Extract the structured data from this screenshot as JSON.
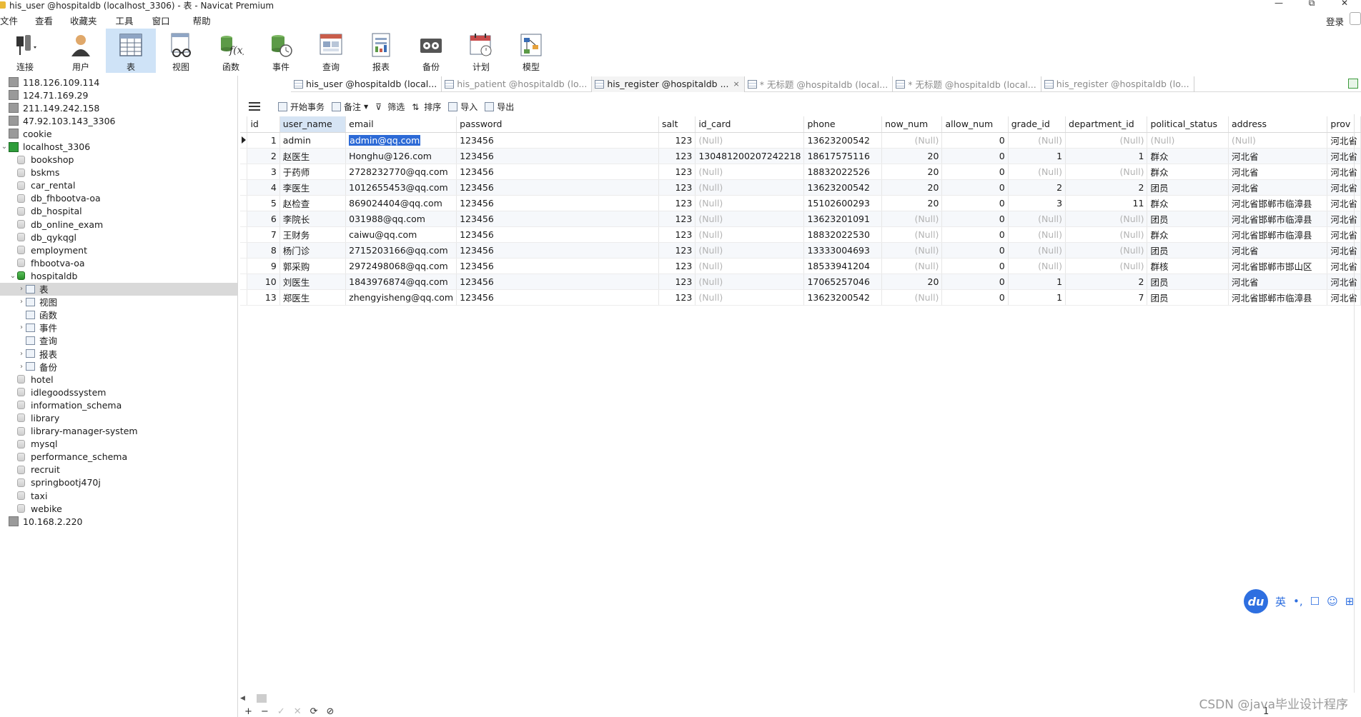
{
  "window": {
    "title": "his_user @hospitaldb (localhost_3306) - 表 - Navicat Premium",
    "minimize": "—",
    "maximize": "⧉",
    "close": "✕"
  },
  "menu": [
    "文件",
    "查看",
    "收藏夹",
    "工具",
    "窗口",
    "帮助"
  ],
  "login_label": "登录",
  "toolbar": [
    {
      "label": "连接",
      "icon": "plug-icon"
    },
    {
      "label": "用户",
      "icon": "user-icon"
    },
    {
      "label": "表",
      "icon": "table-icon",
      "active": true
    },
    {
      "label": "视图",
      "icon": "view-icon"
    },
    {
      "label": "函数",
      "icon": "function-icon"
    },
    {
      "label": "事件",
      "icon": "event-icon"
    },
    {
      "label": "查询",
      "icon": "query-icon"
    },
    {
      "label": "报表",
      "icon": "report-icon"
    },
    {
      "label": "备份",
      "icon": "backup-icon"
    },
    {
      "label": "计划",
      "icon": "schedule-icon"
    },
    {
      "label": "模型",
      "icon": "model-icon"
    }
  ],
  "sidebar": {
    "items": [
      {
        "label": "118.126.109.114",
        "type": "server",
        "level": 0
      },
      {
        "label": "124.71.169.29",
        "type": "server",
        "level": 0
      },
      {
        "label": "211.149.242.158",
        "type": "server",
        "level": 0
      },
      {
        "label": "47.92.103.143_3306",
        "type": "server",
        "level": 0
      },
      {
        "label": "cookie",
        "type": "server",
        "level": 0
      },
      {
        "label": "localhost_3306",
        "type": "server-open",
        "level": 0,
        "expanded": true
      },
      {
        "label": "bookshop",
        "type": "db",
        "level": 1
      },
      {
        "label": "bskms",
        "type": "db",
        "level": 1
      },
      {
        "label": "car_rental",
        "type": "db",
        "level": 1
      },
      {
        "label": "db_fhbootva-oa",
        "type": "db",
        "level": 1
      },
      {
        "label": "db_hospital",
        "type": "db",
        "level": 1
      },
      {
        "label": "db_online_exam",
        "type": "db",
        "level": 1
      },
      {
        "label": "db_qykqgl",
        "type": "db",
        "level": 1
      },
      {
        "label": "employment",
        "type": "db",
        "level": 1
      },
      {
        "label": "fhbootva-oa",
        "type": "db",
        "level": 1
      },
      {
        "label": "hospitaldb",
        "type": "db-open",
        "level": 1,
        "expanded": true
      },
      {
        "label": "表",
        "type": "tables",
        "level": 2,
        "selected": true,
        "collapsed": true
      },
      {
        "label": "视图",
        "type": "views",
        "level": 2,
        "collapsed": true
      },
      {
        "label": "函数",
        "type": "functions",
        "level": 2
      },
      {
        "label": "事件",
        "type": "events",
        "level": 2,
        "collapsed": true
      },
      {
        "label": "查询",
        "type": "queries",
        "level": 2
      },
      {
        "label": "报表",
        "type": "reports",
        "level": 2,
        "collapsed": true
      },
      {
        "label": "备份",
        "type": "backups",
        "level": 2,
        "collapsed": true
      },
      {
        "label": "hotel",
        "type": "db",
        "level": 1
      },
      {
        "label": "idlegoodssystem",
        "type": "db",
        "level": 1
      },
      {
        "label": "information_schema",
        "type": "db",
        "level": 1
      },
      {
        "label": "library",
        "type": "db",
        "level": 1
      },
      {
        "label": "library-manager-system",
        "type": "db",
        "level": 1
      },
      {
        "label": "mysql",
        "type": "db",
        "level": 1
      },
      {
        "label": "performance_schema",
        "type": "db",
        "level": 1
      },
      {
        "label": "recruit",
        "type": "db",
        "level": 1
      },
      {
        "label": "springbootj470j",
        "type": "db",
        "level": 1
      },
      {
        "label": "taxi",
        "type": "db",
        "level": 1
      },
      {
        "label": "webike",
        "type": "db",
        "level": 1
      },
      {
        "label": "10.168.2.220",
        "type": "server",
        "level": 0
      }
    ]
  },
  "tabs": [
    {
      "label": "his_user @hospitaldb (local...",
      "active": false,
      "dim": false
    },
    {
      "label": "his_patient @hospitaldb (lo...",
      "active": false,
      "dim": true
    },
    {
      "label": "his_register @hospitaldb ...",
      "active": true,
      "dim": false,
      "close": "×"
    },
    {
      "label": "* 无标题 @hospitaldb (local...",
      "active": false,
      "dim": true
    },
    {
      "label": "* 无标题 @hospitaldb (local...",
      "active": false,
      "dim": true
    },
    {
      "label": "his_register @hospitaldb (lo...",
      "active": false,
      "dim": true
    }
  ],
  "data_toolbar": [
    "开始事务",
    "备注",
    "筛选",
    "排序",
    "导入",
    "导出"
  ],
  "grid": {
    "columns": [
      "id",
      "user_name",
      "email",
      "password",
      "salt",
      "id_card",
      "phone",
      "now_num",
      "allow_num",
      "grade_id",
      "department_id",
      "political_status",
      "address",
      "prov"
    ],
    "rows": [
      [
        "1",
        "admin",
        "admin@qq.com",
        "123456",
        "123",
        "(Null)",
        "13623200542",
        "(Null)",
        "0",
        "(Null)",
        "(Null)",
        "(Null)",
        "(Null)",
        "河北省"
      ],
      [
        "2",
        "赵医生",
        "Honghu@126.com",
        "123456",
        "123",
        "130481200207242218",
        "18617575116",
        "20",
        "0",
        "1",
        "1",
        "群众",
        "河北省",
        "河北省"
      ],
      [
        "3",
        "于药师",
        "2728232770@qq.com",
        "123456",
        "123",
        "(Null)",
        "18832022526",
        "20",
        "0",
        "(Null)",
        "(Null)",
        "群众",
        "河北省",
        "河北省"
      ],
      [
        "4",
        "李医生",
        "1012655453@qq.com",
        "123456",
        "123",
        "(Null)",
        "13623200542",
        "20",
        "0",
        "2",
        "2",
        "团员",
        "河北省",
        "河北省"
      ],
      [
        "5",
        "赵检查",
        "869024404@qq.com",
        "123456",
        "123",
        "(Null)",
        "15102600293",
        "20",
        "0",
        "3",
        "11",
        "群众",
        "河北省邯郸市临漳县",
        "河北省"
      ],
      [
        "6",
        "李院长",
        "031988@qq.com",
        "123456",
        "123",
        "(Null)",
        "13623201091",
        "(Null)",
        "0",
        "(Null)",
        "(Null)",
        "团员",
        "河北省邯郸市临漳县",
        "河北省"
      ],
      [
        "7",
        "王财务",
        "caiwu@qq.com",
        "123456",
        "123",
        "(Null)",
        "18832022530",
        "(Null)",
        "0",
        "(Null)",
        "(Null)",
        "群众",
        "河北省邯郸市临漳县",
        "河北省"
      ],
      [
        "8",
        "杨门诊",
        "2715203166@qq.com",
        "123456",
        "123",
        "(Null)",
        "13333004693",
        "(Null)",
        "0",
        "(Null)",
        "(Null)",
        "团员",
        "河北省",
        "河北省"
      ],
      [
        "9",
        "郭采购",
        "2972498068@qq.com",
        "123456",
        "123",
        "(Null)",
        "18533941204",
        "(Null)",
        "0",
        "(Null)",
        "(Null)",
        "群核",
        "河北省邯郸市邯山区",
        "河北省"
      ],
      [
        "10",
        "刘医生",
        "1843976874@qq.com",
        "123456",
        "123",
        "(Null)",
        "17065257046",
        "20",
        "0",
        "1",
        "2",
        "团员",
        "河北省",
        "河北省"
      ],
      [
        "13",
        "郑医生",
        "zhengyisheng@qq.com",
        "123456",
        "123",
        "(Null)",
        "13623200542",
        "(Null)",
        "0",
        "1",
        "7",
        "团员",
        "河北省邯郸市临漳县",
        "河北省"
      ]
    ],
    "selected_cell": {
      "row": 0,
      "col": 2
    }
  },
  "bottom": {
    "record_controls": [
      "+",
      "−",
      "✓",
      "✕",
      "⟳",
      "⊘"
    ],
    "page": "1"
  },
  "ime": {
    "logo": "du",
    "items": [
      "英",
      "•,",
      "☐",
      "☺",
      "⊞"
    ]
  },
  "watermark": "CSDN @java毕业设计程序",
  "colors": {
    "accent": "#2d6ad6",
    "active_toolbar": "#cfe3f7",
    "null_text": "#b3b3b3"
  }
}
